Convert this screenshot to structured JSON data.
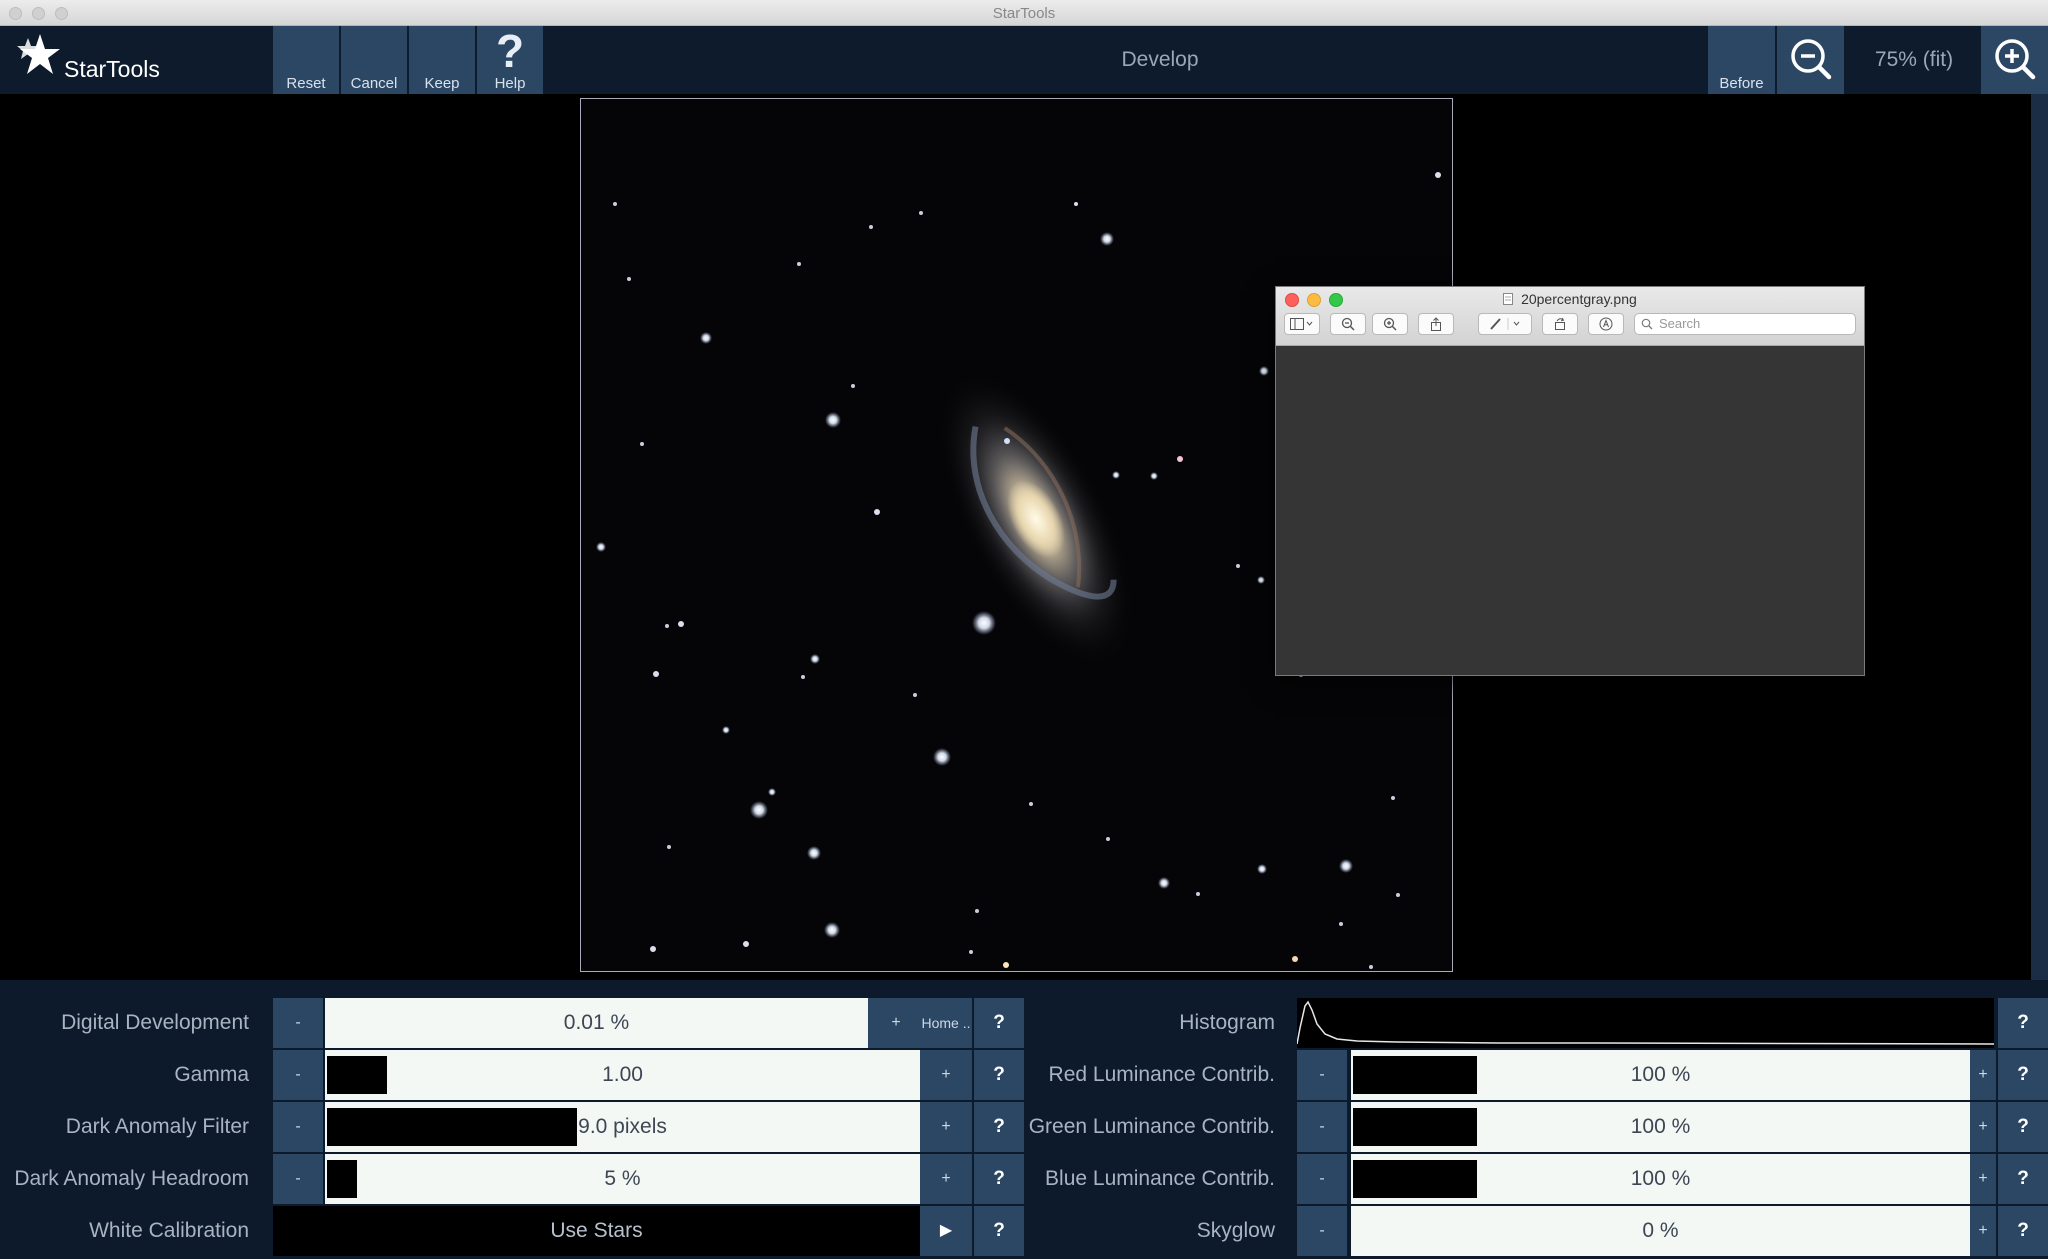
{
  "window": {
    "title": "StarTools"
  },
  "app": {
    "logo_text": "StarTools"
  },
  "toolbar": {
    "reset_label": "Reset",
    "cancel_label": "Cancel",
    "keep_label": "Keep",
    "help_label": "Help",
    "help_glyph": "?",
    "module_title": "Develop",
    "before_label": "Before",
    "zoom_label": "75% (fit)"
  },
  "preview_window": {
    "title": "20percentgray.png",
    "search_placeholder": "Search"
  },
  "controls_left": [
    {
      "label": "Digital Development",
      "value": "0.01 %",
      "fill": 0.0001,
      "minus": "-",
      "plus": "+",
      "extra": "Home ..",
      "help": "?"
    },
    {
      "label": "Gamma",
      "value": "1.00",
      "fill": 0.1,
      "minus": "-",
      "plus": "+",
      "help": "?"
    },
    {
      "label": "Dark Anomaly Filter",
      "value": "9.0 pixels",
      "fill": 0.42,
      "minus": "-",
      "plus": "+",
      "help": "?"
    },
    {
      "label": "Dark Anomaly Headroom",
      "value": "5 %",
      "fill": 0.05,
      "minus": "-",
      "plus": "+",
      "help": "?"
    },
    {
      "label": "White Calibration",
      "value": "Use Stars",
      "arrow": "▶",
      "help": "?"
    }
  ],
  "controls_right": [
    {
      "label": "Histogram",
      "help": "?"
    },
    {
      "label": "Red Luminance Contrib.",
      "value": "100 %",
      "fill": 0.2,
      "minus": "-",
      "plus": "+",
      "help": "?"
    },
    {
      "label": "Green Luminance Contrib.",
      "value": "100 %",
      "fill": 0.2,
      "minus": "-",
      "plus": "+",
      "help": "?"
    },
    {
      "label": "Blue Luminance Contrib.",
      "value": "100 %",
      "fill": 0.2,
      "minus": "-",
      "plus": "+",
      "help": "?"
    },
    {
      "label": "Skyglow",
      "value": "0 %",
      "fill": 0,
      "minus": "-",
      "plus": "+",
      "help": "?"
    }
  ],
  "colors": {
    "toolbar_bg": "#0d1b2c",
    "button_bg": "#2b4764",
    "track_bg": "#f4f8f4"
  }
}
